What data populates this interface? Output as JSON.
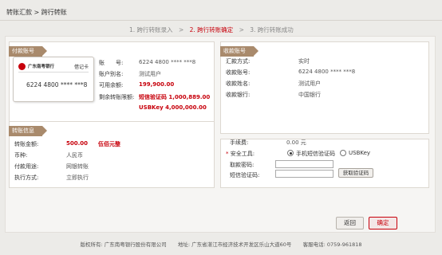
{
  "breadcrumb": "转账汇款 > 跨行转账",
  "steps": [
    {
      "label": "1. 跨行转账录入",
      "current": false
    },
    {
      "label": "2. 跨行转账确定",
      "current": true
    },
    {
      "label": "3. 跨行转账成功",
      "current": false
    }
  ],
  "step_separator": ">",
  "payer": {
    "tag": "付款账号",
    "card": {
      "bank_name": "广东南粤银行",
      "card_type": "借记卡",
      "number": "6224 4800 **** ***8"
    },
    "account_no_label": "账　　号:",
    "account_no": "6224 4800 **** ***8",
    "alias_label": "账户别名:",
    "alias": "测试用户",
    "balance_label": "可用余额:",
    "balance": "199,900.00",
    "limit_label": "剩余转账限额:",
    "limit_sms": "短信验证码 1,000,889.00",
    "limit_usbkey": "USBKey 4,000,000.00"
  },
  "payee": {
    "tag": "收款账号",
    "rows": [
      {
        "label": "汇款方式:",
        "value": "实时"
      },
      {
        "label": "收款账号:",
        "value": "6224 4800 **** ***8"
      },
      {
        "label": "收款姓名:",
        "value": "测试用户"
      },
      {
        "label": "收款银行:",
        "value": "中国银行"
      }
    ]
  },
  "transfer": {
    "tag": "转账信息",
    "amount_label": "转账金额:",
    "amount": "500.00",
    "amount_upper": "伍佰元整",
    "currency_label": "币种:",
    "currency": "人民币",
    "purpose_label": "付款用途:",
    "purpose": "网银转账",
    "mode_label": "执行方式:",
    "mode": "立即执行"
  },
  "security": {
    "fee_label": "手续费:",
    "fee": "0.00 元",
    "tool_label": "安全工具:",
    "required_mark": "*",
    "options": [
      "手机短信验证码",
      "USBKey"
    ],
    "selected": "手机短信验证码",
    "password_label": "取款密码:",
    "password_value": "",
    "sms_label": "短信验证码:",
    "sms_value": "",
    "sms_button": "获取验证码"
  },
  "actions": {
    "back": "返回",
    "confirm": "确定"
  },
  "footer": {
    "copyright": "版权所有: 广东南粤银行股份有限公司",
    "address": "地址: 广东省湛江市经济技术开发区乐山大道60号",
    "hotline": "客服电话: 0759-961818"
  },
  "colors": {
    "accent": "#c7000b",
    "tag": "#a98a6c",
    "background": "#ecebe8"
  },
  "icons": {
    "bank_logo": "bank-logo-icon"
  }
}
